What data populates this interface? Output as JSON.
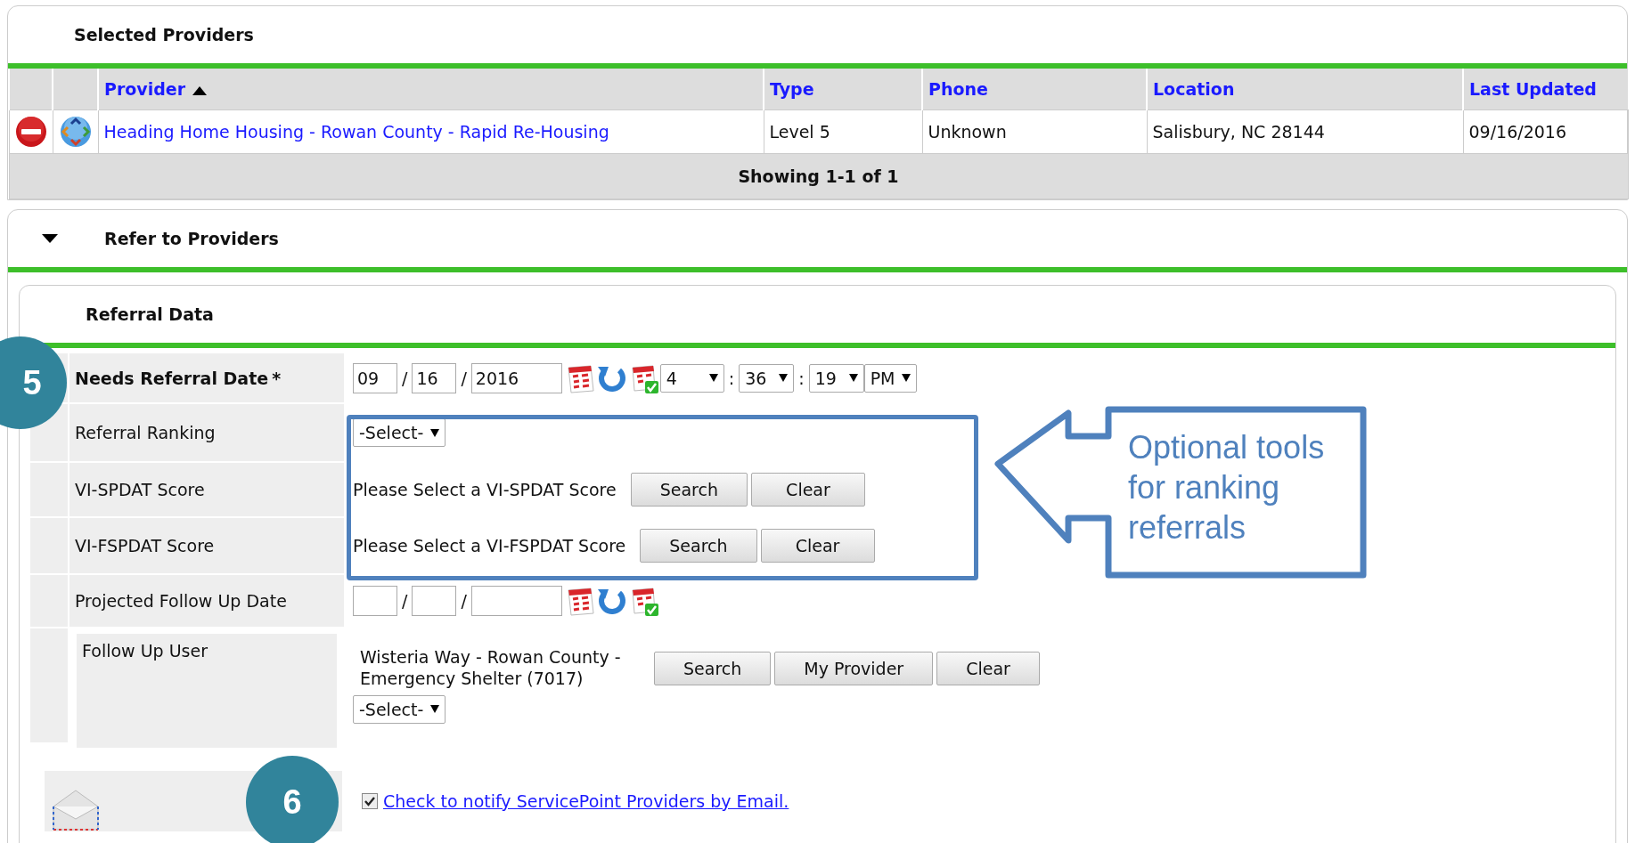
{
  "selected_providers": {
    "title": "Selected Providers",
    "columns": [
      {
        "label": "Provider",
        "sorted": true
      },
      {
        "label": "Type",
        "sorted": false
      },
      {
        "label": "Phone",
        "sorted": false
      },
      {
        "label": "Location",
        "sorted": false
      },
      {
        "label": "Last Updated",
        "sorted": false
      }
    ],
    "rows": [
      {
        "provider": "Heading Home Housing - Rowan County - Rapid Re-Housing",
        "type": "Level 5",
        "phone": "Unknown",
        "location": "Salisbury, NC 28144",
        "last_updated": "09/16/2016"
      }
    ],
    "footer": "Showing 1-1 of 1"
  },
  "refer_section": {
    "title": "Refer to Providers",
    "expanded": true
  },
  "referral_data": {
    "title": "Referral Data",
    "fields": [
      {
        "kind": "datetime",
        "label": "Needs Referral Date",
        "required": true,
        "required_mark": "*",
        "date_separator": "/",
        "month": "09",
        "day": "16",
        "year": "2016",
        "time_separator": ":",
        "time_parts": [
          "4",
          "36",
          "19"
        ],
        "ampm": "PM"
      },
      {
        "kind": "select",
        "label": "Referral Ranking",
        "required": false,
        "value": "-Select-"
      },
      {
        "kind": "lookup",
        "label": "VI-SPDAT Score",
        "required": false,
        "text": "Please Select a VI-SPDAT Score",
        "buttons": [
          "Search",
          "Clear"
        ]
      },
      {
        "kind": "lookup",
        "label": "VI-FSPDAT Score",
        "required": false,
        "text": "Please Select a VI-FSPDAT Score",
        "buttons": [
          "Search",
          "Clear"
        ]
      },
      {
        "kind": "date",
        "label": "Projected Follow Up Date",
        "required": false,
        "date_separator": "/"
      },
      {
        "kind": "user",
        "label": "Follow Up User",
        "required": false,
        "text": "Wisteria Way - Rowan County - Emergency Shelter (7017)",
        "buttons": [
          "Search",
          "My Provider",
          "Clear"
        ],
        "select": "-Select-"
      }
    ]
  },
  "notify_email": {
    "checked": true,
    "label": "Check to notify ServicePoint Providers by Email."
  },
  "step_markers": [
    {
      "label": "5"
    },
    {
      "label": "6"
    }
  ],
  "callout": {
    "text": "Optional tools for ranking referrals"
  }
}
